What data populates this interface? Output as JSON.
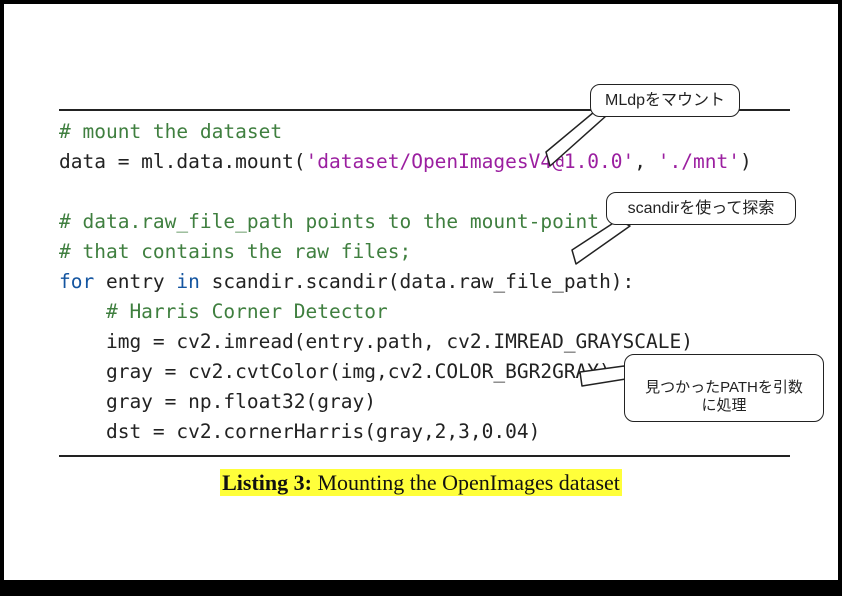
{
  "code": {
    "c1": "# mount the dataset",
    "l2a": "data = ml.data.mount(",
    "l2s1": "'dataset/OpenImagesV4@1.0.0'",
    "l2b": ", ",
    "l2s2": "'./mnt'",
    "l2c": ")",
    "c3a": "# data.raw_file_path points to the mount-point",
    "c3b": "# that contains the raw files;",
    "kw_for": "for",
    "l4a": " entry ",
    "kw_in": "in",
    "l4b": " scandir.scandir(data.raw_file_path):",
    "c5": "    # Harris Corner Detector",
    "l6": "    img = cv2.imread(entry.path, cv2.IMREAD_GRAYSCALE)",
    "l7": "    gray = cv2.cvtColor(img,cv2.COLOR_BGR2GRAY)",
    "l8": "    gray = np.float32(gray)",
    "l9": "    dst = cv2.cornerHarris(gray,2,3,0.04)"
  },
  "caption": {
    "label": "Listing 3:",
    "text": " Mounting the OpenImages dataset"
  },
  "callouts": {
    "c1": "MLdpをマウント",
    "c2": "scandirを使って探索",
    "c3": "見つかったPATHを引数\nに処理"
  }
}
